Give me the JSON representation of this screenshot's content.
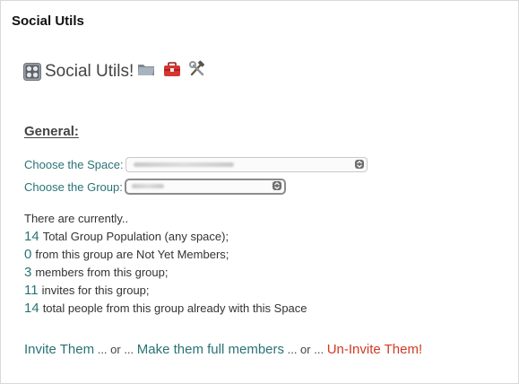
{
  "panel": {
    "title": "Social Utils"
  },
  "app": {
    "name": "Social Utils!",
    "icons": [
      "control-knobs-icon",
      "folder-icon",
      "toolbox-icon",
      "hammer-wrench-icon"
    ]
  },
  "general": {
    "heading": "General:",
    "space_label": "Choose the Space:",
    "group_label": "Choose the Group:"
  },
  "stats": {
    "intro": "There are currently..",
    "total_population": {
      "value": "14",
      "text": "Total Group Population (any space);"
    },
    "not_yet_members": {
      "value": "0",
      "text": "from this group are Not Yet Members;"
    },
    "members": {
      "value": "3",
      "text": "members from this group;"
    },
    "invites": {
      "value": "11",
      "text": "invites for this group;"
    },
    "with_space": {
      "value": "14",
      "text": "total people from this group already with this Space"
    }
  },
  "actions": {
    "invite": "Invite Them",
    "make_members": "Make them full members",
    "uninvite": "Un-Invite Them!",
    "separator": " ... or ... "
  },
  "colors": {
    "link": "#2a7376",
    "danger": "#d23a23",
    "text": "#333333"
  }
}
